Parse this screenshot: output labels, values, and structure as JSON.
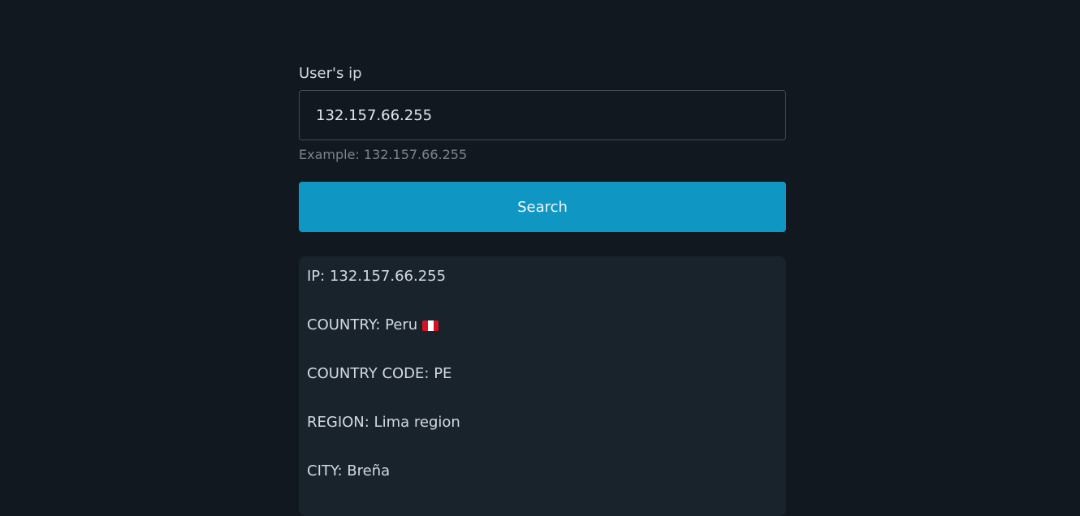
{
  "form": {
    "label": "User's ip",
    "input_value": "132.157.66.255",
    "help_text": "Example: 132.157.66.255",
    "search_label": "Search"
  },
  "result": {
    "ip": "IP: 132.157.66.255",
    "country": "COUNTRY: Peru",
    "country_flag_icon": "peru-flag-icon",
    "flag_colors": [
      "#d91023",
      "#ffffff",
      "#d91023"
    ],
    "country_code": "COUNTRY CODE: PE",
    "region": "REGION: Lima region",
    "city": "CITY: Breña"
  },
  "colors": {
    "background": "#12181f",
    "accent": "#1096c3",
    "panel": "#19232c"
  }
}
